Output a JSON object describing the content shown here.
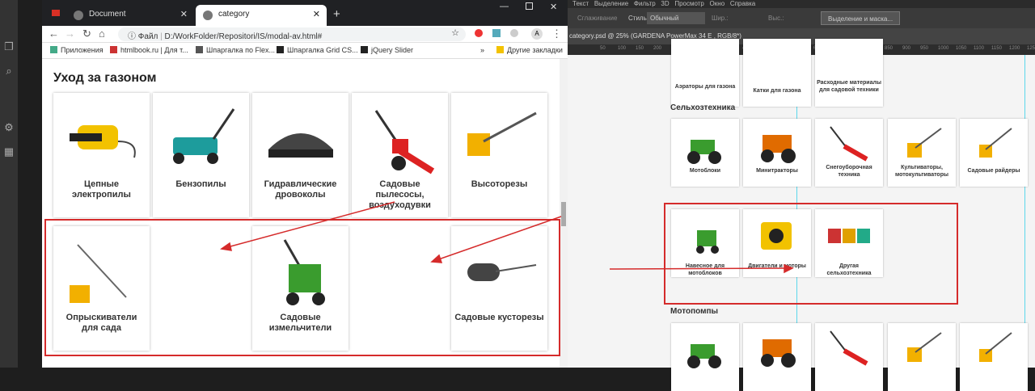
{
  "chrome": {
    "tabs": [
      "Document",
      "category"
    ],
    "new_tab": "+",
    "omnibox_scheme": "Файл",
    "url": "D:/WorkFolder/Repositori/IS/modal-av.html#",
    "profile": "A",
    "bookmarks": [
      "Приложения",
      "htmlbook.ru | Для т...",
      "Шпаргалка по Flex...",
      "Шпаргалка Grid CS...",
      "jQuery Slider",
      "»",
      "Другие закладки"
    ]
  },
  "page": {
    "title": "Уход за газоном",
    "row1": [
      {
        "label": "Цепные электропилы"
      },
      {
        "label": "Бензопилы"
      },
      {
        "label": "Гидравлические дровоколы"
      },
      {
        "label": "Садовые пылесосы, воздуходувки"
      },
      {
        "label": "Высоторезы"
      }
    ],
    "row2": [
      {
        "label": "Опрыскиватели для сада"
      },
      {
        "label": "Садовые измельчители"
      },
      {
        "label": "Садовые кусторезы"
      }
    ]
  },
  "photoshop": {
    "menu": [
      "Текст",
      "Выделение",
      "Фильтр",
      "3D",
      "Просмотр",
      "Окно",
      "Справка"
    ],
    "options_label": "Сглаживание",
    "style_label": "Стиль:",
    "style_value": "Обычный",
    "width_label": "Шир.:",
    "height_label": "Выс.:",
    "select_mask_button": "Выделение и маска...",
    "doc_tab": "category.psd @ 25% (GARDENA PowerMax 34 E , RGB/8*)",
    "ruler": [
      "50",
      "100",
      "150",
      "200",
      "250",
      "300",
      "350",
      "400",
      "450",
      "500",
      "550",
      "600",
      "650",
      "700",
      "750",
      "800",
      "850",
      "900",
      "950",
      "1000",
      "1050",
      "1100",
      "1150",
      "1200",
      "1250"
    ],
    "top_row": [
      "Аэраторы для газона",
      "Катки для газона",
      "Расходные материалы для садовой техники"
    ],
    "section1": "Сельхозтехника",
    "row_a": [
      "Мотоблоки",
      "Минитракторы",
      "Снегоуборочная техника",
      "Культиваторы, мотокультиваторы",
      "Садовые райдеры"
    ],
    "row_b": [
      "Навесное для мотоблоков",
      "Двигатели и моторы",
      "Другая сельхозтехника"
    ],
    "section2": "Мотопомпы"
  },
  "colors": {
    "highlight": "#d52b2b",
    "accent": "#3a9c2e",
    "guide": "#5bd7ec"
  }
}
